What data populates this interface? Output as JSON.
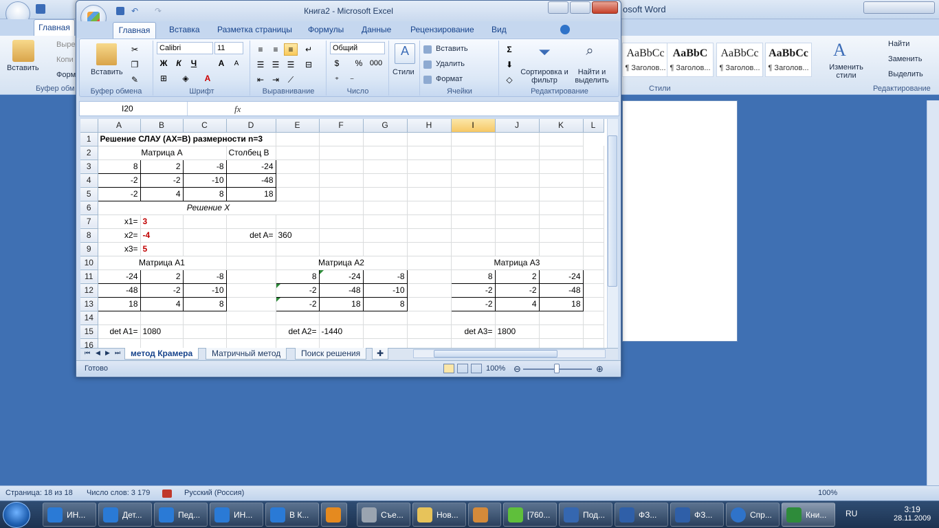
{
  "word": {
    "title_fragment": "osoft Word",
    "tab_home": "Главная",
    "clipboard": {
      "paste": "Вставить",
      "cut": "Выре",
      "copy": "Копи",
      "format": "Форм",
      "group": "Буфер обм"
    },
    "styles": [
      {
        "sample": "AaBbCc",
        "name": "¶ Заголов..."
      },
      {
        "sample": "AaBbC",
        "name": "¶ Заголов..."
      },
      {
        "sample": "AaBbCc",
        "name": "¶ Заголов..."
      },
      {
        "sample": "AaBbCc",
        "name": "¶ Заголов..."
      }
    ],
    "change_styles": "Изменить стили",
    "styles_group": "Стили",
    "edit": {
      "find": "Найти",
      "replace": "Заменить",
      "select": "Выделить",
      "group": "Редактирование"
    },
    "status": {
      "page": "Страница: 18 из 18",
      "words": "Число слов: 3 179",
      "lang": "Русский (Россия)",
      "zoom": "100%"
    }
  },
  "excel": {
    "title": "Книга2 - Microsoft Excel",
    "tabs": [
      "Главная",
      "Вставка",
      "Разметка страницы",
      "Формулы",
      "Данные",
      "Рецензирование",
      "Вид"
    ],
    "ribbon": {
      "clipboard": {
        "paste": "Вставить",
        "group": "Буфер обмена"
      },
      "font": {
        "name": "Calibri",
        "size": "11",
        "bold": "Ж",
        "italic": "К",
        "underline": "Ч",
        "grow": "A",
        "shrink": "A",
        "group": "Шрифт"
      },
      "align": {
        "group": "Выравнивание"
      },
      "number": {
        "format": "Общий",
        "percent": "%",
        "thousands": "000",
        "group": "Число"
      },
      "styles": {
        "label": "Стили"
      },
      "cells": {
        "insert": "Вставить",
        "delete": "Удалить",
        "format": "Формат",
        "group": "Ячейки"
      },
      "editing": {
        "sum": "Σ",
        "sort": "Сортировка и фильтр",
        "find": "Найти и выделить",
        "group": "Редактирование"
      }
    },
    "name_box": "I20",
    "fx": "fx",
    "columns": [
      "A",
      "B",
      "C",
      "D",
      "E",
      "F",
      "G",
      "H",
      "I",
      "J",
      "K",
      "L"
    ],
    "selected_column": "I",
    "rows": {
      "r1": {
        "n": "1",
        "A": "Решение СЛАУ (AX=B) размерности n=3"
      },
      "r2": {
        "n": "2",
        "matA": "Матрица А",
        "colB": "Столбец В"
      },
      "r3": {
        "n": "3",
        "A": "8",
        "B": "2",
        "C": "-8",
        "D": "-24"
      },
      "r4": {
        "n": "4",
        "A": "-2",
        "B": "-2",
        "C": "-10",
        "D": "-48"
      },
      "r5": {
        "n": "5",
        "A": "-2",
        "B": "4",
        "C": "8",
        "D": "18"
      },
      "r6": {
        "n": "6",
        "sol": "Решение X"
      },
      "r7": {
        "n": "7",
        "lbl": "x1=",
        "val": "3"
      },
      "r8": {
        "n": "8",
        "lbl": "x2=",
        "val": "-4",
        "detlbl": "det A=",
        "det": "360"
      },
      "r9": {
        "n": "9",
        "lbl": "x3=",
        "val": "5"
      },
      "r10": {
        "n": "10",
        "m1": "Матрица А1",
        "m2": "Матрица А2",
        "m3": "Матрица А3"
      },
      "r11": {
        "n": "11",
        "a1": [
          "-24",
          "2",
          "-8"
        ],
        "a2": [
          "8",
          "-24",
          "-8"
        ],
        "a3": [
          "8",
          "2",
          "-24"
        ]
      },
      "r12": {
        "n": "12",
        "a1": [
          "-48",
          "-2",
          "-10"
        ],
        "a2": [
          "-2",
          "-48",
          "-10"
        ],
        "a3": [
          "-2",
          "-2",
          "-48"
        ]
      },
      "r13": {
        "n": "13",
        "a1": [
          "18",
          "4",
          "8"
        ],
        "a2": [
          "-2",
          "18",
          "8"
        ],
        "a3": [
          "-2",
          "4",
          "18"
        ]
      },
      "r14": {
        "n": "14"
      },
      "r15": {
        "n": "15",
        "d1l": "det A1=",
        "d1": "1080",
        "d2l": "det A2=",
        "d2": "-1440",
        "d3l": "det A3=",
        "d3": "1800"
      },
      "r16": {
        "n": "16"
      }
    },
    "sheet_tabs": [
      "метод Крамера",
      "Матричный метод",
      "Поиск решения"
    ],
    "status": {
      "ready": "Готово",
      "zoom": "100%"
    }
  },
  "taskbar": {
    "items": [
      "ИН...",
      "Дет...",
      "Пед...",
      "ИН...",
      "В К...",
      "",
      "Съе...",
      "Нов...",
      "",
      "[760...",
      "Под...",
      "ФЗ...",
      "ФЗ...",
      "Спр...",
      "Кни..."
    ],
    "lang": "RU",
    "time": "3:19",
    "date": "28.11.2009"
  }
}
